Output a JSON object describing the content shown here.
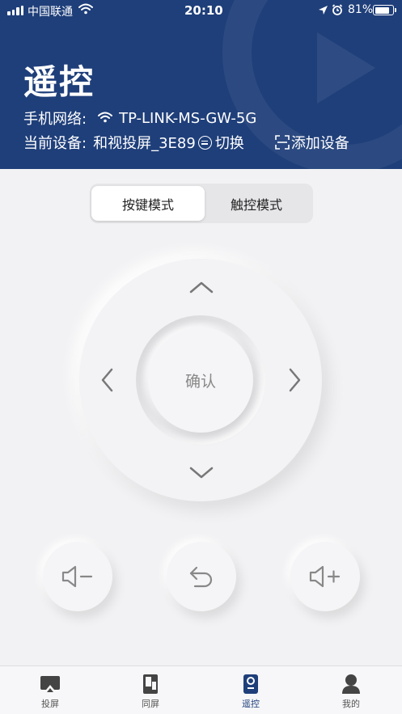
{
  "status": {
    "carrier": "中国联通",
    "time": "20:10",
    "battery": "81%",
    "battery_level": 0.81
  },
  "header": {
    "title": "遥控",
    "network_label": "手机网络:",
    "network_name": "TP-LINK-MS-GW-5G",
    "device_label": "当前设备:",
    "device_name": "和视投屏_3E89",
    "switch_label": "切换",
    "add_device_label": "添加设备"
  },
  "modes": {
    "key_mode": "按键模式",
    "touch_mode": "触控模式",
    "selected": "按键模式"
  },
  "dpad": {
    "ok_label": "确认"
  },
  "tabbar": {
    "items": [
      {
        "label": "投屏",
        "icon": "cast-icon"
      },
      {
        "label": "同屏",
        "icon": "mirror-icon"
      },
      {
        "label": "遥控",
        "icon": "remote-icon"
      },
      {
        "label": "我的",
        "icon": "profile-icon"
      }
    ],
    "active": "遥控"
  },
  "colors": {
    "header_bg": "#1f3f7a",
    "accent": "#1f3f7a",
    "page_bg": "#f2f2f4"
  }
}
